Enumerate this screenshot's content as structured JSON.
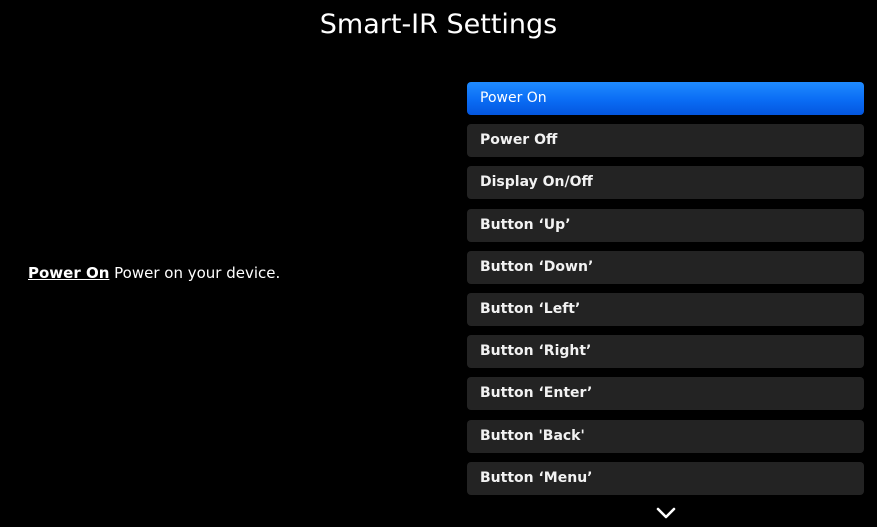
{
  "header": {
    "title": "Smart-IR Settings"
  },
  "description": {
    "title": "Power On",
    "text": " Power on your device."
  },
  "menu": {
    "items": [
      {
        "label": "Power On",
        "selected": true
      },
      {
        "label": "Power Off",
        "selected": false
      },
      {
        "label": "Display On/Off",
        "selected": false
      },
      {
        "label": "Button ‘Up’",
        "selected": false
      },
      {
        "label": "Button ‘Down’",
        "selected": false
      },
      {
        "label": "Button ‘Left’",
        "selected": false
      },
      {
        "label": "Button ‘Right’",
        "selected": false
      },
      {
        "label": "Button ‘Enter’",
        "selected": false
      },
      {
        "label": "Button 'Back'",
        "selected": false
      },
      {
        "label": "Button ‘Menu’",
        "selected": false
      }
    ],
    "scroll_icon": "chevron-down-icon"
  },
  "colors": {
    "background": "#000000",
    "item_background": "#232323",
    "selected_accent": "#0a6cf4",
    "text": "#ffffff"
  }
}
